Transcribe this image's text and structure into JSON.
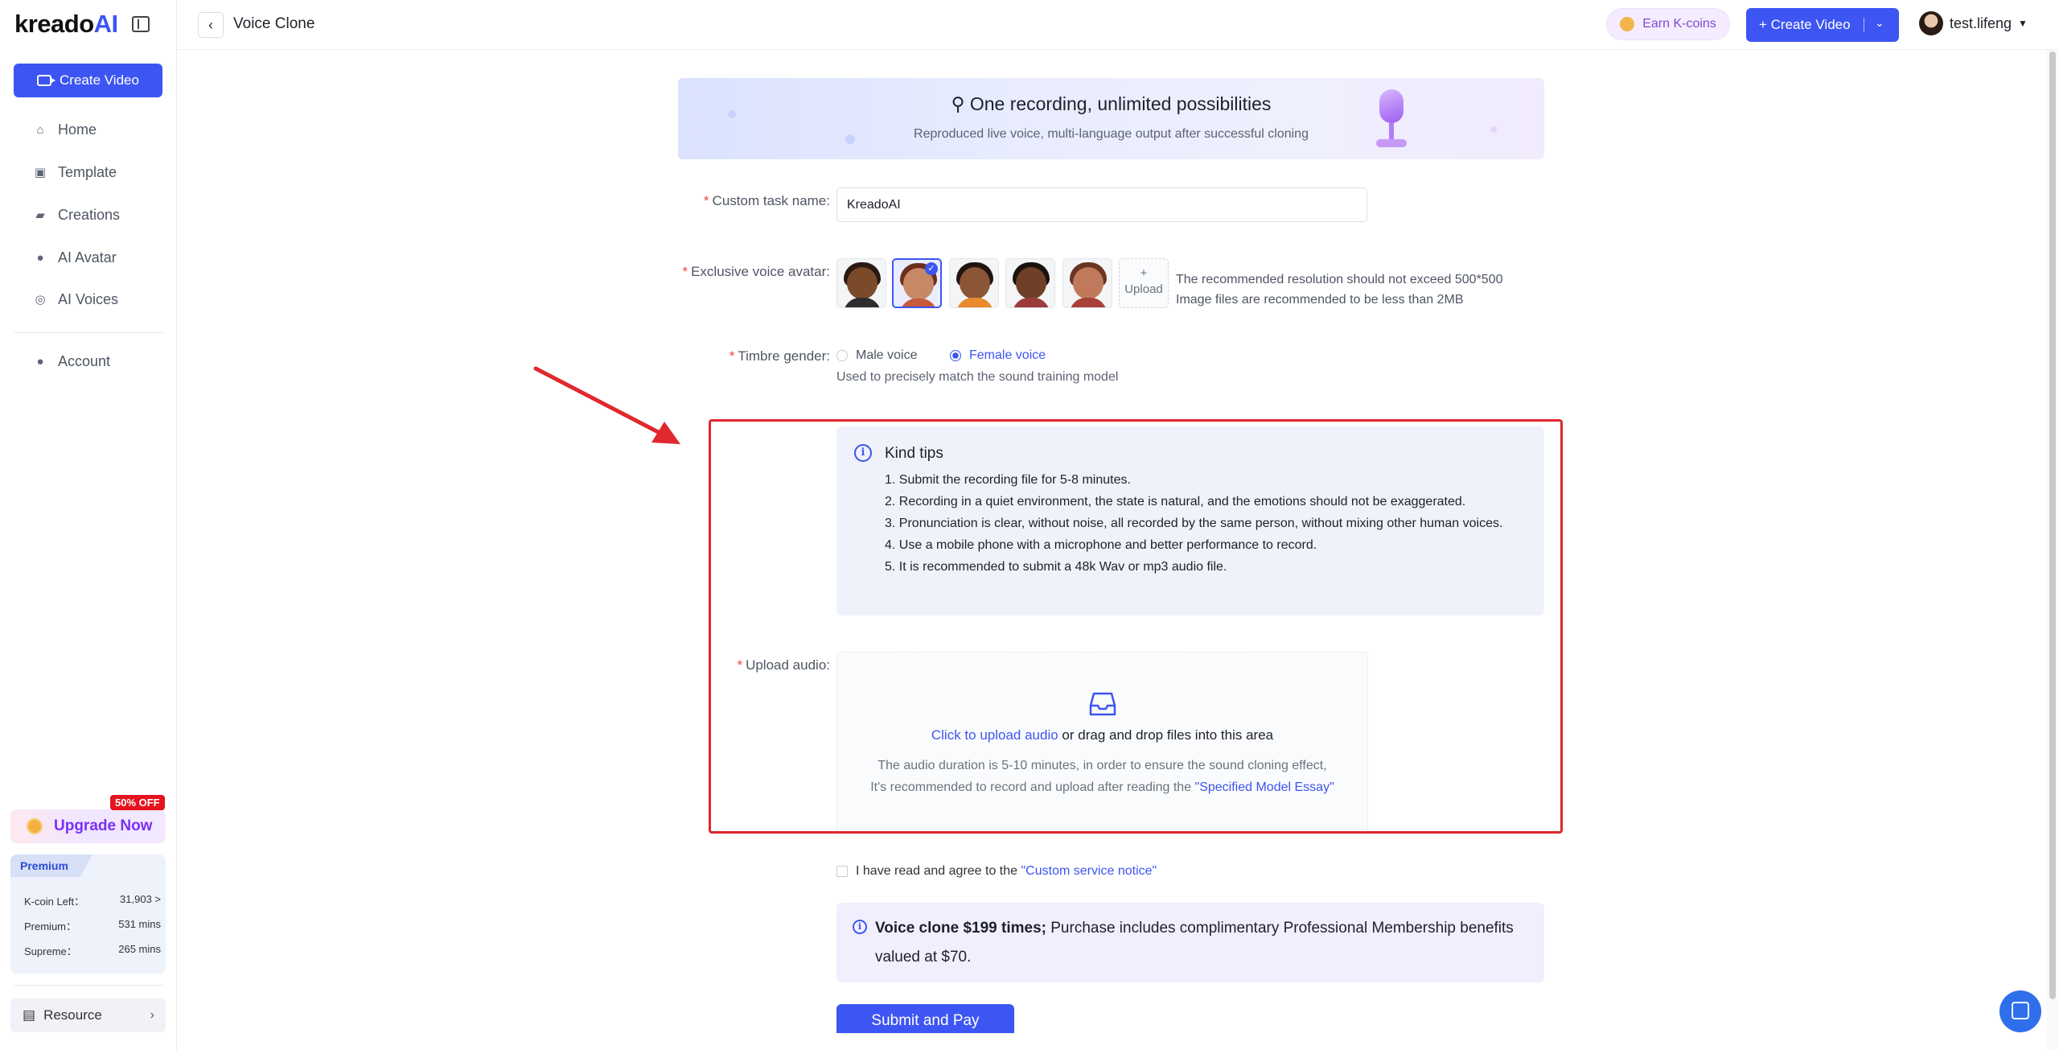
{
  "brand": {
    "logo_main": "kreado",
    "logo_ai": "AI"
  },
  "sidebar": {
    "create_label": "Create Video",
    "items": [
      {
        "label": "Home",
        "icon": "home-icon"
      },
      {
        "label": "Template",
        "icon": "template-icon"
      },
      {
        "label": "Creations",
        "icon": "folder-icon"
      },
      {
        "label": "AI Avatar",
        "icon": "avatar-icon"
      },
      {
        "label": "AI Voices",
        "icon": "voice-icon"
      }
    ],
    "account_label": "Account",
    "off_badge": "50% OFF",
    "upgrade_label": "Upgrade Now",
    "premium": {
      "tag": "Premium",
      "rows": [
        {
          "label": "K-coin Left：",
          "value": "31,903 >"
        },
        {
          "label": "Premium：",
          "value": "531 mins"
        },
        {
          "label": "Supreme：",
          "value": "265 mins"
        }
      ]
    },
    "resource_label": "Resource"
  },
  "header": {
    "title": "Voice Clone",
    "earn_label": "Earn K-coins",
    "create_label": "+ Create Video",
    "username": "test.lifeng"
  },
  "banner": {
    "title": "One recording, unlimited possibilities",
    "subtitle": "Reproduced live voice, multi-language output after successful cloning"
  },
  "form": {
    "task_label": "Custom task name:",
    "task_value": "KreadoAI",
    "avatar_label": "Exclusive voice avatar:",
    "upload_plus": "+",
    "upload_label": "Upload",
    "avatar_hint_1": "The recommended resolution should not exceed 500*500",
    "avatar_hint_2": "Image files are recommended to be less than 2MB",
    "gender_label": "Timbre gender:",
    "male_label": "Male voice",
    "female_label": "Female voice",
    "gender_hint": "Used to precisely match the sound training model",
    "upload_audio_label": "Upload audio:"
  },
  "tips": {
    "title": "Kind tips",
    "items": [
      "1. Submit the recording file for 5-8 minutes.",
      "2. Recording in a quiet environment, the state is natural, and the emotions should not be exaggerated.",
      "3. Pronunciation is clear, without noise, all recorded by the same person, without mixing other human voices.",
      "4. Use a mobile phone with a microphone and better performance to record.",
      "5. It is recommended to submit a 48k Wav or mp3 audio file."
    ]
  },
  "upload_zone": {
    "link": "Click to upload audio",
    "rest": " or drag and drop files into this area",
    "note_1": "The audio duration is 5-10 minutes, in order to ensure the sound cloning effect,",
    "note_2_prefix": "It's recommended to record and upload after reading the ",
    "note_2_link": "\"Specified Model Essay\""
  },
  "agreement": {
    "text": "I have read and agree to the ",
    "link": "\"Custom service notice\""
  },
  "price": {
    "bold": "Voice clone $199 times;",
    "rest": " Purchase includes complimentary Professional Membership benefits valued at $70."
  },
  "submit_label": "Submit and Pay",
  "colors": {
    "accent": "#3d55f2",
    "highlight": "#e0282e",
    "upgrade": "#7b2ff7"
  }
}
